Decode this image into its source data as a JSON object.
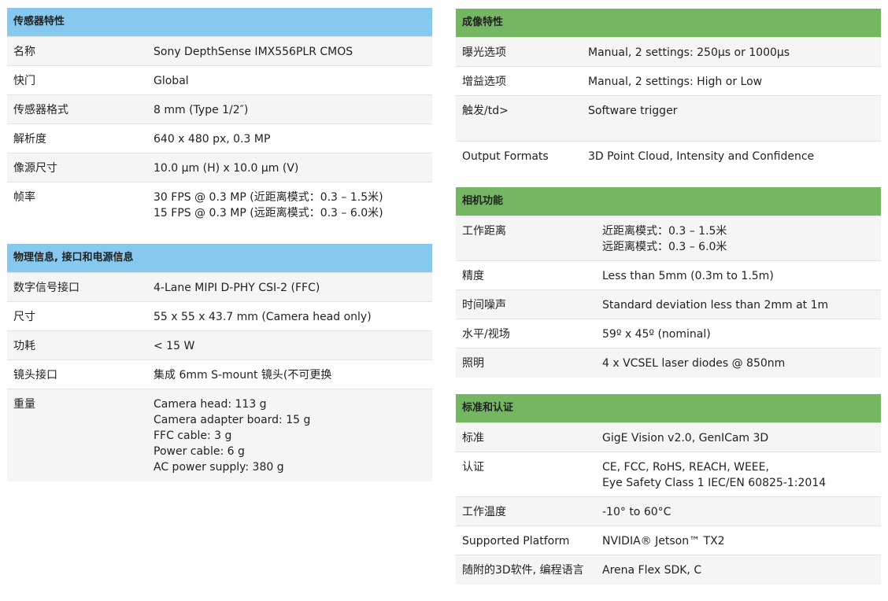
{
  "colors": {
    "blue_header": "#87c9ee",
    "green_header": "#74b661",
    "row_alt": "#f5f5f5"
  },
  "sensor": {
    "title": "传感器特性",
    "rows": [
      {
        "label": "名称",
        "value": "Sony DepthSense IMX556PLR CMOS"
      },
      {
        "label": "快门",
        "value": "Global"
      },
      {
        "label": "传感器格式",
        "value": "8 mm (Type 1/2″)"
      },
      {
        "label": "解析度",
        "value": "640 x 480 px, 0.3 MP"
      },
      {
        "label": "像源尺寸",
        "value": "10.0 µm (H) x 10.0 µm (V)"
      },
      {
        "label": "帧率",
        "value": "30 FPS @ 0.3 MP (近距离模式：0.3 – 1.5米)\n15 FPS @ 0.3 MP (远距离模式：0.3 – 6.0米)"
      }
    ]
  },
  "physical": {
    "title": "物理信息, 接口和电源信息",
    "rows": [
      {
        "label": "数字信号接口",
        "value": "4-Lane MIPI D-PHY CSI-2 (FFC)"
      },
      {
        "label": "尺寸",
        "value": "55 x 55 x 43.7 mm (Camera head only)"
      },
      {
        "label": "功耗",
        "value": "< 15 W"
      },
      {
        "label": "镜头接口",
        "value": "集成 6mm S-mount 镜头(不可更换"
      },
      {
        "label": "重量",
        "value": "Camera head: 113 g\nCamera adapter board: 15 g\nFFC cable: 3 g\nPower cable: 6 g\nAC power supply: 380 g"
      }
    ]
  },
  "imaging": {
    "title": "成像特性",
    "rows": [
      {
        "label": "曝光选项",
        "value": "Manual, 2 settings: 250μs or 1000μs"
      },
      {
        "label": "增益选项",
        "value": "Manual, 2 settings: High or Low"
      },
      {
        "label": "触发/td>",
        "value": "Software trigger"
      },
      {
        "label": "Output Formats",
        "value": "3D Point Cloud, Intensity and Confidence"
      }
    ]
  },
  "camera": {
    "title": "相机功能",
    "rows": [
      {
        "label": "工作距离",
        "value": "近距离模式：0.3 – 1.5米\n远距离模式：0.3 – 6.0米"
      },
      {
        "label": "精度",
        "value": "Less than 5mm (0.3m to 1.5m)"
      },
      {
        "label": "时间噪声",
        "value": "Standard deviation less than 2mm at 1m"
      },
      {
        "label": "水平/视场",
        "value": "59º x 45º (nominal)"
      },
      {
        "label": "照明",
        "value": "4 x VCSEL laser diodes @ 850nm"
      }
    ]
  },
  "standards": {
    "title": "标准和认证",
    "rows": [
      {
        "label": "标准",
        "value": "GigE Vision v2.0, GenICam 3D"
      },
      {
        "label": "认证",
        "value": "CE, FCC, RoHS, REACH, WEEE,\nEye Safety Class 1 IEC/EN 60825-1:2014"
      },
      {
        "label": "工作温度",
        "value": "-10° to 60°C"
      },
      {
        "label": "Supported Platform",
        "value": "NVIDIA® Jetson™ TX2"
      },
      {
        "label": "随附的3D软件, 编程语言",
        "value": "Arena Flex SDK, C"
      }
    ]
  }
}
